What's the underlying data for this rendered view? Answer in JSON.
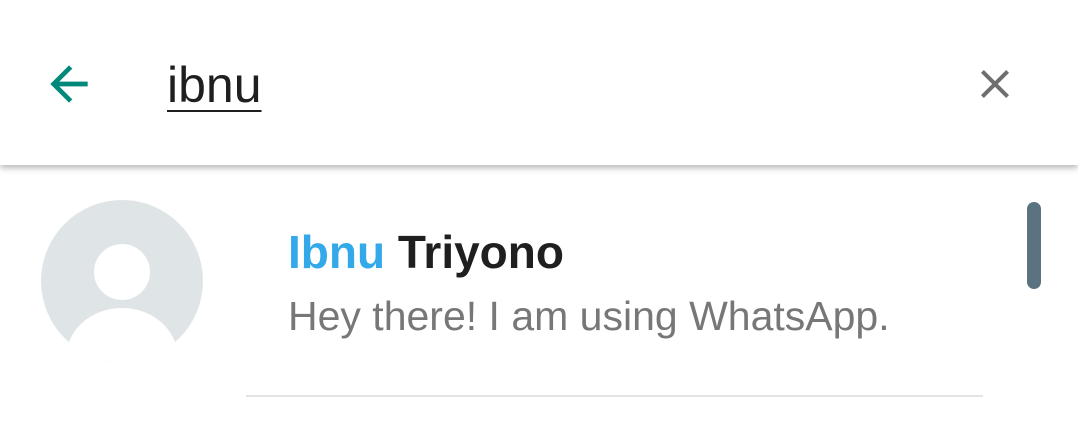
{
  "search": {
    "back_icon": "arrow-left-icon",
    "query": "ibnu",
    "clear_icon": "close-icon",
    "accent_color": "#00897b"
  },
  "results": [
    {
      "name_match": "Ibnu",
      "name_rest": " Triyono",
      "status": "Hey there! I am using WhatsApp.",
      "avatar_icon": "default-avatar-icon",
      "highlight_color": "#34a9e9"
    }
  ]
}
